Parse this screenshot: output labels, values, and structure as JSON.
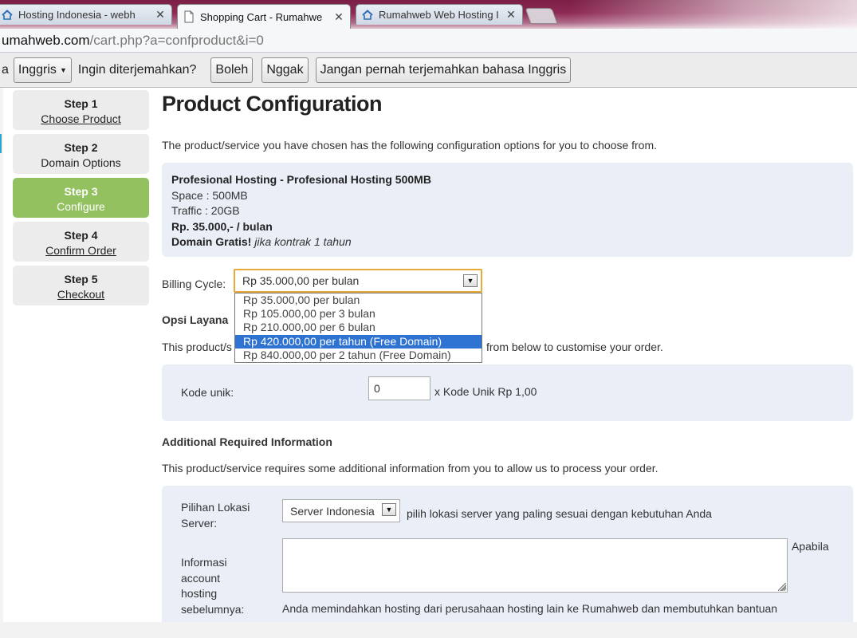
{
  "browser": {
    "tabs": [
      {
        "title": "Hosting Indonesia - webh",
        "icon": "house-icon"
      },
      {
        "title": "Shopping Cart - Rumahwe",
        "icon": "page-icon"
      },
      {
        "title": "Rumahweb Web Hosting I",
        "icon": "house-icon"
      }
    ],
    "url_host": "umahweb.com",
    "url_path": "/cart.php?a=confproduct&i=0"
  },
  "translate": {
    "prefix": "a",
    "language": "Inggris",
    "question": "Ingin diterjemahkan?",
    "yes": "Boleh",
    "no": "Nggak",
    "never": "Jangan pernah terjemahkan bahasa Inggris"
  },
  "steps": [
    {
      "num": "Step 1",
      "label": "Choose Product"
    },
    {
      "num": "Step 2",
      "label": "Domain Options"
    },
    {
      "num": "Step 3",
      "label": "Configure"
    },
    {
      "num": "Step 4",
      "label": "Confirm Order"
    },
    {
      "num": "Step 5",
      "label": "Checkout"
    }
  ],
  "page": {
    "title": "Product Configuration",
    "intro": "The product/service you have chosen has the following configuration options for you to choose from."
  },
  "product": {
    "name": "Profesional Hosting - Profesional Hosting 500MB",
    "space": "Space : 500MB",
    "traffic": "Traffic : 20GB",
    "price": "Rp. 35.000,- / bulan",
    "domain_bold": "Domain Gratis!",
    "domain_italic": "jika kontrak 1 tahun"
  },
  "billing": {
    "label": "Billing Cycle:",
    "selected": "Rp 35.000,00 per bulan",
    "options": [
      "Rp 35.000,00 per bulan",
      "Rp 105.000,00 per 3 bulan",
      "Rp 210.000,00 per 6 bulan",
      "Rp 420.000,00 per tahun (Free Domain)",
      "Rp 840.000,00 per 2 tahun (Free Domain)"
    ],
    "highlighted_index": 3
  },
  "options_section": {
    "heading": "Opsi Layana",
    "text_start": "This product/s",
    "text_end": "from below to customise your order."
  },
  "kode": {
    "label": "Kode unik:",
    "value": "0",
    "suffix": "x Kode Unik Rp 1,00"
  },
  "additional": {
    "heading": "Additional Required Information",
    "text": "This product/service requires some additional information from you to allow us to process your order.",
    "server_label_1": "Pilihan Lokasi",
    "server_label_2": "Server:",
    "server_value": "Server Indonesia",
    "server_help": "pilih lokasi server yang paling sesuai dengan kebutuhan Anda",
    "info_label_1": "Informasi",
    "info_label_2": "account",
    "info_label_3": "hosting",
    "info_label_4": "sebelumnya:",
    "info_side": "Apabila",
    "info_help": "Anda memindahkan hosting dari perusahaan hosting lain ke Rumahweb dan membutuhkan bantuan"
  }
}
